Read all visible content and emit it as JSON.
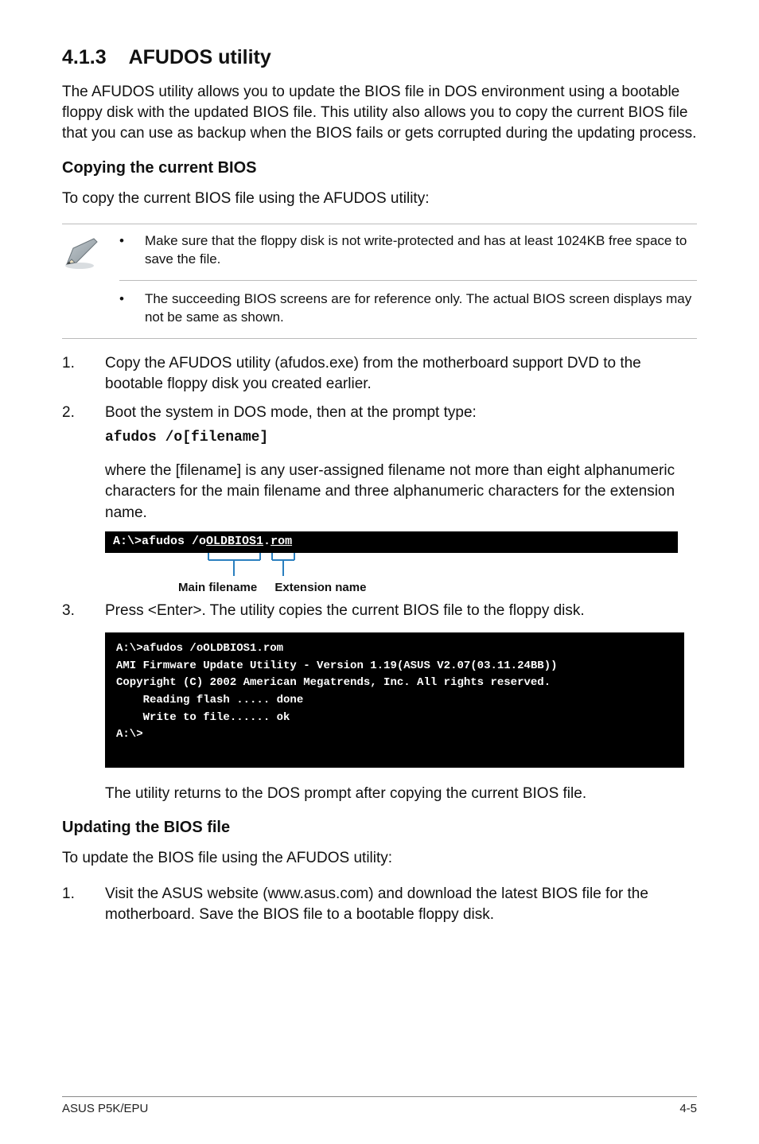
{
  "section": {
    "number": "4.1.3",
    "title": "AFUDOS utility"
  },
  "intro": "The AFUDOS utility allows you to update the BIOS file in DOS environment using a bootable floppy disk with the updated BIOS file. This utility also allows you to copy the current BIOS file that you can use as backup when the BIOS fails or gets corrupted during the updating process.",
  "copy": {
    "heading": "Copying the current BIOS",
    "lead": "To copy the current BIOS file using the AFUDOS utility:",
    "notes": [
      "Make sure that the floppy disk is not write-protected and has at least 1024KB free space to save the file.",
      "The succeeding BIOS screens are for reference only. The actual BIOS screen displays may not be same as shown."
    ],
    "steps": {
      "s1": "Copy the AFUDOS utility (afudos.exe) from the motherboard support DVD to the bootable floppy disk you created earlier.",
      "s2": "Boot the system in DOS mode, then at the prompt type:",
      "s2code": "afudos /o[filename]",
      "s2explain": "where the [filename] is any user-assigned filename not more than eight alphanumeric characters  for the main filename and three alphanumeric characters for the extension name.",
      "s3": "Press <Enter>. The utility copies the current BIOS file to the floppy disk."
    },
    "diagram": {
      "prompt": "A:\\>afudos /o",
      "main": "OLDBIOS1",
      "dot": ".",
      "ext": "rom",
      "main_label": "Main filename",
      "ext_label": "Extension name"
    },
    "terminal": "A:\\>afudos /oOLDBIOS1.rom\nAMI Firmware Update Utility - Version 1.19(ASUS V2.07(03.11.24BB))\nCopyright (C) 2002 American Megatrends, Inc. All rights reserved.\n    Reading flash ..... done\n    Write to file...... ok\nA:\\>",
    "after_terminal": "The utility returns to the DOS prompt after copying the current BIOS file."
  },
  "update": {
    "heading": "Updating the BIOS file",
    "lead": "To update the BIOS file using the AFUDOS utility:",
    "step1": "Visit the ASUS website (www.asus.com) and download the latest BIOS file for the motherboard. Save the BIOS file to a bootable floppy disk."
  },
  "footer": {
    "left": "ASUS P5K/EPU",
    "right": "4-5"
  },
  "labels": {
    "bullet": "•",
    "n1": "1.",
    "n2": "2.",
    "n3": "3."
  }
}
